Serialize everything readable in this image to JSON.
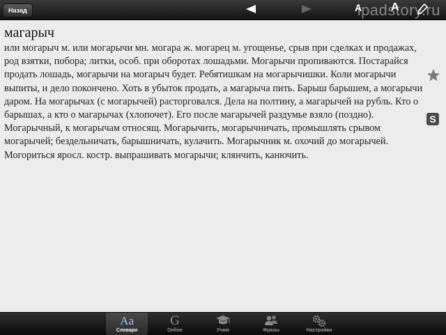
{
  "toolbar": {
    "back_label": "Назад",
    "watermark": "ipadstory.ru",
    "font_decrease_label": "A",
    "font_increase_label": "A"
  },
  "entry": {
    "title": "магарыч",
    "body": "или могарыч м. или могарычи мн. могара ж. могарец м. угощенье, срыв при сделках и продажах, род взятки, побора; литки, особ. при оборотах лошадьми. Могарычи пропиваются. Постарайся продать лошадь, могарычи на могарыч будет. Ребятишкам на могарычишки. Коли могарычи выпиты, и дело покончено. Хоть в убыток продать, а магарыча пить. Барыш барышем, а могарычи даром. На могарычах (с могарычей) расторговался. Дела на полтину, а магарычей на рубль. Кто о барышах, а кто о магарычах (хлопочет). Его после магарычей раздумье взяло (поздно). Могарычный, к могарычам относящ. Могарычить, могарычничать, промышлять срывом могарычей; бездельничать, барышничать, кулачить. Могарычник м. охочий до могарычей. Могориться яросл. костр. выпрашивать могарычи; клянчить, канючить."
  },
  "side_badge": "S",
  "tabs": [
    {
      "label": "Словари",
      "glyph": "Aa"
    },
    {
      "label": "Online",
      "glyph": "G"
    },
    {
      "label": "Учим"
    },
    {
      "label": "Фразы"
    },
    {
      "label": "Настройки"
    }
  ]
}
